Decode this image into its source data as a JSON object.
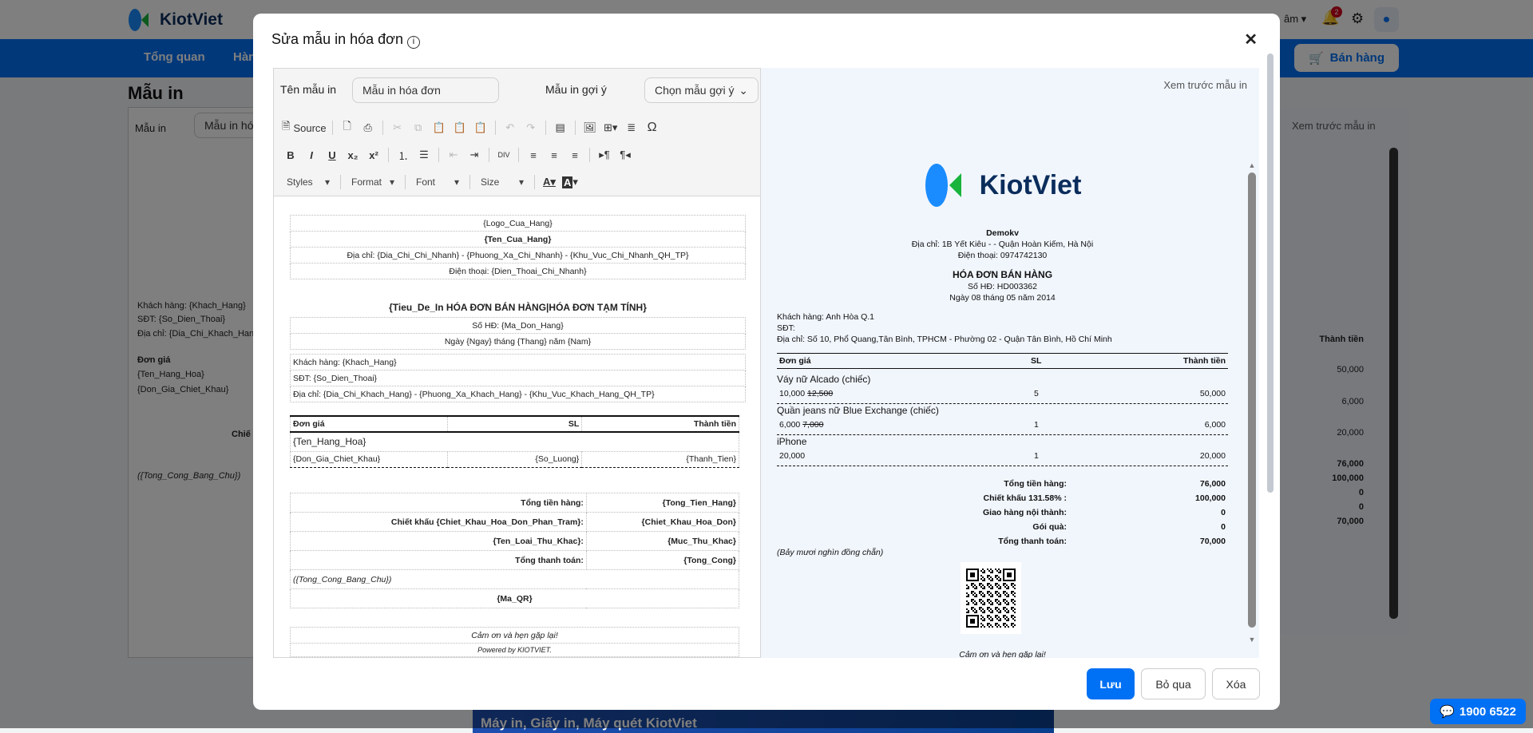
{
  "app": {
    "logo": "KiotViet",
    "nav": [
      "Tổng quan",
      "Hàng"
    ],
    "menu_partial": "âm",
    "notifications": "2",
    "sell_button": "Bán hàng",
    "page_title": "Mẫu in",
    "template_label": "Mẫu in",
    "template_value": "Mẫu in hó",
    "preview_label": "Xem trước mẫu in",
    "bg_lines": [
      "Khách hàng: {Khach_Hang}",
      "SĐT: {So_Dien_Thoai}",
      "Địa chỉ: {Dia_Chi_Khach_Hang}",
      "Đơn giá",
      "{Ten_Hang_Hoa}",
      "{Don_Gia_Chiet_Khau}",
      "Chiế",
      "({Tong_Cong_Bang_Chu})"
    ],
    "bg_values": [
      "Thành tiền",
      "50,000",
      "6,000",
      "20,000",
      "76,000",
      "100,000",
      "0",
      "0",
      "70,000"
    ],
    "banner": "Máy in, Giấy in, Máy quét KiotViet",
    "hotline": "1900 6522"
  },
  "dialog": {
    "title": "Sửa mẫu in hóa đơn",
    "name_label": "Tên mẫu in",
    "name_value": "Mẫu in hóa đơn",
    "suggest_label": "Mẫu in gợi ý",
    "suggest_value": "Chọn mẫu gợi ý",
    "toolbar": {
      "source": "Source",
      "styles": "Styles",
      "format": "Format",
      "font": "Font",
      "size": "Size"
    },
    "template": {
      "header": [
        "{Logo_Cua_Hang}",
        "{Ten_Cua_Hang}",
        "Địa chỉ: {Dia_Chi_Chi_Nhanh} - {Phuong_Xa_Chi_Nhanh} - {Khu_Vuc_Chi_Nhanh_QH_TP}",
        "Điện thoại: {Dien_Thoai_Chi_Nhanh}"
      ],
      "title": "{Tieu_De_In HÓA ĐƠN BÁN HÀNG|HÓA ĐƠN TẠM TÍNH}",
      "invoice": [
        "Số HĐ: {Ma_Don_Hang}",
        "Ngày {Ngay} tháng {Thang} năm {Nam}"
      ],
      "customer": [
        "Khách hàng: {Khach_Hang}",
        "SĐT: {So_Dien_Thoai}",
        "Địa chỉ: {Dia_Chi_Khach_Hang} - {Phuong_Xa_Khach_Hang} - {Khu_Vuc_Khach_Hang_QH_TP}"
      ],
      "columns": [
        "Đơn giá",
        "SL",
        "Thành tiền"
      ],
      "item_name": "{Ten_Hang_Hoa}",
      "item_cells": [
        "{Don_Gia_Chiet_Khau}",
        "{So_Luong}",
        "{Thanh_Tien}"
      ],
      "totals": [
        [
          "Tổng tiền hàng:",
          "{Tong_Tien_Hang}"
        ],
        [
          "Chiết khấu {Chiet_Khau_Hoa_Don_Phan_Tram}:",
          "{Chiet_Khau_Hoa_Don}"
        ],
        [
          "{Ten_Loai_Thu_Khac}:",
          "{Muc_Thu_Khac}"
        ],
        [
          "Tổng thanh toán:",
          "{Tong_Cong}"
        ]
      ],
      "in_words": "({Tong_Cong_Bang_Chu})",
      "qr": "{Ma_QR}",
      "footer": [
        "Cảm ơn và hẹn gặp lại!",
        "Powered by KIOTVIET."
      ]
    },
    "preview": {
      "label": "Xem trước mẫu in",
      "logo": "KiotViet",
      "store": "Demokv",
      "address": "Địa chỉ: 1B Yết Kiêu - - Quận Hoàn Kiếm, Hà Nội",
      "phone": "Điện thoại: 0974742130",
      "title": "HÓA ĐƠN BÁN HÀNG",
      "invoice_no": "Số HĐ: HD003362",
      "date": "Ngày 08 tháng 05 năm 2014",
      "customer": "Khách hàng: Anh Hòa Q.1",
      "customer_phone": "SĐT:",
      "customer_address": "Địa chỉ: Số 10, Phổ Quang,Tân Bình, TPHCM - Phường 02 - Quận Tân Bình, Hồ Chí Minh",
      "columns": [
        "Đơn giá",
        "SL",
        "Thành tiền"
      ],
      "items": [
        {
          "name": "Váy nữ Alcado (chiếc)",
          "price": "10,000",
          "old_price": "12,500",
          "qty": "5",
          "total": "50,000"
        },
        {
          "name": "Quần jeans nữ Blue Exchange (chiếc)",
          "price": "6,000",
          "old_price": "7,000",
          "qty": "1",
          "total": "6,000"
        },
        {
          "name": "iPhone",
          "price": "20,000",
          "old_price": "",
          "qty": "1",
          "total": "20,000"
        }
      ],
      "totals": [
        [
          "Tổng tiền hàng:",
          "76,000"
        ],
        [
          "Chiết khấu 131.58% :",
          "100,000"
        ],
        [
          "Giao hàng nội thành:",
          "0"
        ],
        [
          "Gói quà:",
          "0"
        ],
        [
          "Tổng thanh toán:",
          "70,000"
        ]
      ],
      "in_words": "(Bảy mươi nghìn đồng chẵn)",
      "thanks": "Cảm ơn và hẹn gặp lại!"
    },
    "buttons": {
      "save": "Lưu",
      "cancel": "Bỏ qua",
      "delete": "Xóa"
    }
  },
  "colors": {
    "primary": "#0070f4",
    "nav": "#0070f4",
    "preview_bg": "#f1f6fd",
    "badge": "#d0021b"
  }
}
